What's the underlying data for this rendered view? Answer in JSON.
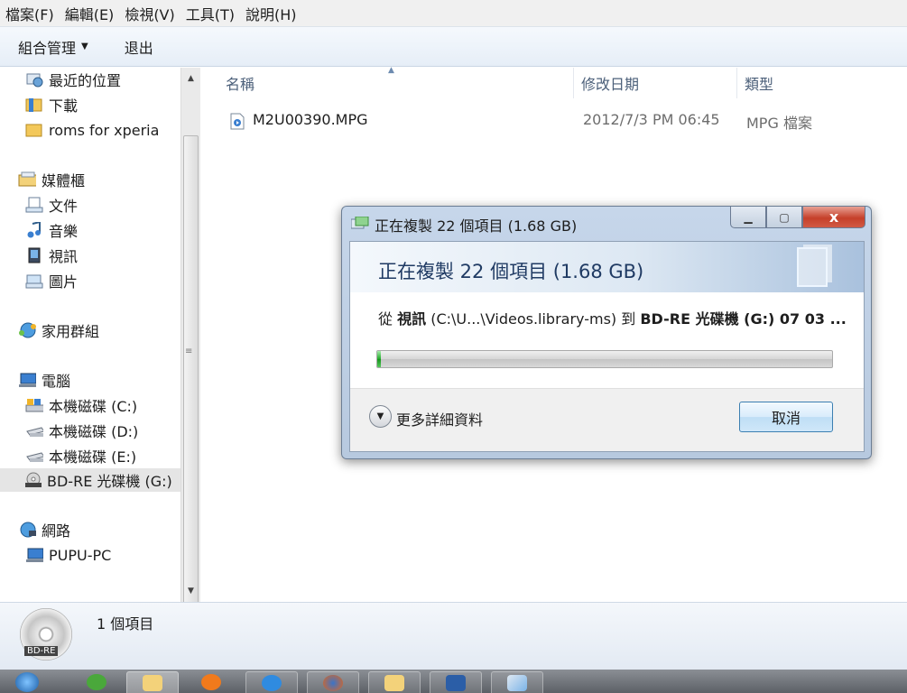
{
  "menu": [
    "檔案(F)",
    "編輯(E)",
    "檢視(V)",
    "工具(T)",
    "說明(H)"
  ],
  "commands": {
    "organize": "組合管理",
    "eject": "退出"
  },
  "nav": {
    "recent": "最近的位置",
    "downloads": "下載",
    "roms": "roms for xperia",
    "libraries": "媒體櫃",
    "documents": "文件",
    "music": "音樂",
    "videos": "視訊",
    "pictures": "圖片",
    "homegroup": "家用群組",
    "computer": "電腦",
    "drive_c": "本機磁碟 (C:)",
    "drive_d": "本機磁碟 (D:)",
    "drive_e": "本機磁碟 (E:)",
    "drive_g": "BD-RE 光碟機 (G:)",
    "network": "網路",
    "pc": "PUPU-PC"
  },
  "columns": {
    "name": "名稱",
    "modified": "修改日期",
    "type": "類型"
  },
  "files": [
    {
      "name": "M2U00390.MPG",
      "modified": "2012/7/3 PM 06:45",
      "type": "MPG 檔案"
    }
  ],
  "details": {
    "count": "1 個項目",
    "disc_label": "BD-RE"
  },
  "dialog": {
    "title": "正在複製 22 個項目 (1.68 GB)",
    "heading": "正在複製 22 個項目 (1.68 GB)",
    "from_word": "從",
    "from_name": "視訊",
    "from_path": "(C:\\U...\\Videos.library-ms)",
    "to_word": "到",
    "to_name": "BD-RE 光碟機 (G:) 07 03 ...",
    "progress_fraction": 0.008,
    "more_details": "更多詳細資料",
    "cancel": "取消",
    "close_symbol": "x"
  },
  "colors": {
    "accent": "#3c7fb1",
    "progress": "#1fa827",
    "close": "#c5402a"
  }
}
